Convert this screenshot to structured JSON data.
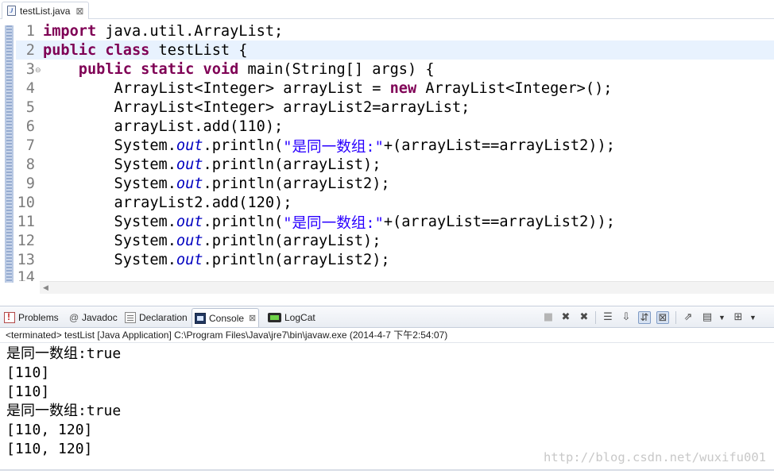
{
  "editor_tab": {
    "title": "testList.java",
    "close": "⊠"
  },
  "code": {
    "line_numbers": [
      "1",
      "2",
      "3",
      "4",
      "5",
      "6",
      "7",
      "8",
      "9",
      "10",
      "11",
      "12",
      "13",
      "14"
    ],
    "l1_kw": "import",
    "l1_rest": " java.util.ArrayList;",
    "l2_kw1": "public",
    "l2_kw2": "class",
    "l2_rest": " testList {",
    "l3_indent": "    ",
    "l3_kw1": "public",
    "l3_kw2": "static",
    "l3_kw3": "void",
    "l3_rest": " main(String[] args) {",
    "l4_a": "        ArrayList<Integer> arrayList = ",
    "l4_kw": "new",
    "l4_b": " ArrayList<Integer>();",
    "l5": "        ArrayList<Integer> arrayList2=arrayList;",
    "l6": "        arrayList.add(110);",
    "sys": "        System.",
    "out": "out",
    "println": ".println(",
    "l7_str": "\"是同一数组:\"",
    "l7_rest": "+(arrayList==arrayList2));",
    "l8_rest": "arrayList);",
    "l9_rest": "arrayList2);",
    "l10": "        arrayList2.add(120);",
    "fold_marker": "⊖"
  },
  "views": {
    "tabs": {
      "problems": "Problems",
      "javadoc": "Javadoc",
      "javadoc_icon": "@",
      "declaration": "Declaration",
      "console": "Console",
      "logcat": "LogCat"
    },
    "console_close": "⊠",
    "toolbar": {
      "terminate": "■",
      "remove": "✖",
      "remove_all": "✖",
      "clear": "☰",
      "scroll_lock": "⇩",
      "pin": "⇵",
      "word_wrap": "⊠",
      "open": "⇗",
      "display": "▤",
      "new": "⊞",
      "dropdown": "▼"
    }
  },
  "console": {
    "header": "<terminated> testList [Java Application] C:\\Program Files\\Java\\jre7\\bin\\javaw.exe (2014-4-7 下午2:54:07)",
    "output": [
      "是同一数组:true",
      "[110]",
      "[110]",
      "是同一数组:true",
      "[110, 120]",
      "[110, 120]"
    ]
  },
  "watermark": "http://blog.csdn.net/wuxifu001",
  "colors": {
    "keyword": "#7f0055",
    "string": "#2a00ff",
    "field": "#0000c0",
    "current_line": "#e8f2fe"
  }
}
